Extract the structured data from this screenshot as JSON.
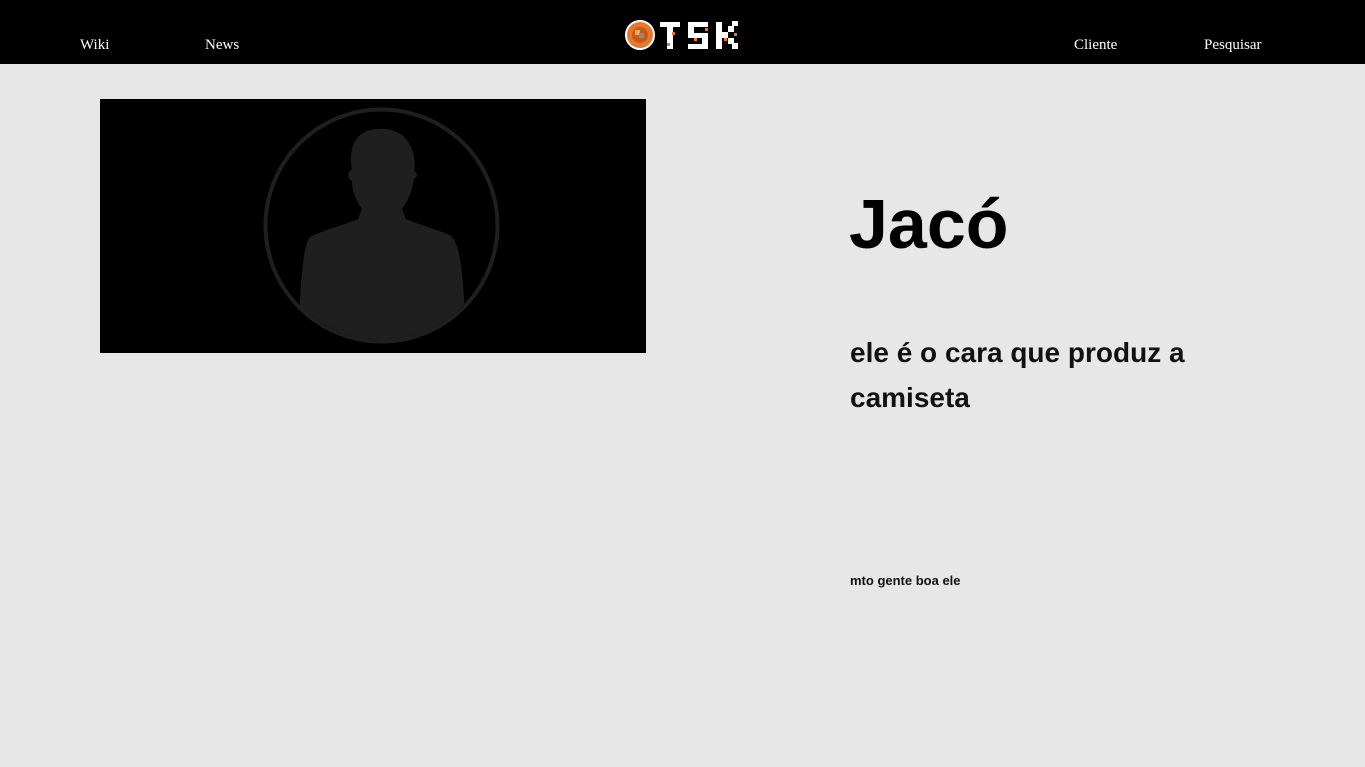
{
  "nav": {
    "left": [
      "Wiki",
      "News"
    ],
    "right": [
      "Cliente",
      "Pesquisar"
    ],
    "logo_text": "OTSK",
    "logo_icon": "orange-ball-icon"
  },
  "profile": {
    "photo_icon": "person-silhouette-icon",
    "name": "Jacó",
    "role": "ele é o cara que produz a camiseta",
    "note": "mto gente boa ele"
  },
  "colors": {
    "header_bg": "#000000",
    "page_bg": "#e7e7e7",
    "nav_text": "#ffffff",
    "logo_accent": "#e8772e",
    "silhouette": "#1f1f1f"
  }
}
